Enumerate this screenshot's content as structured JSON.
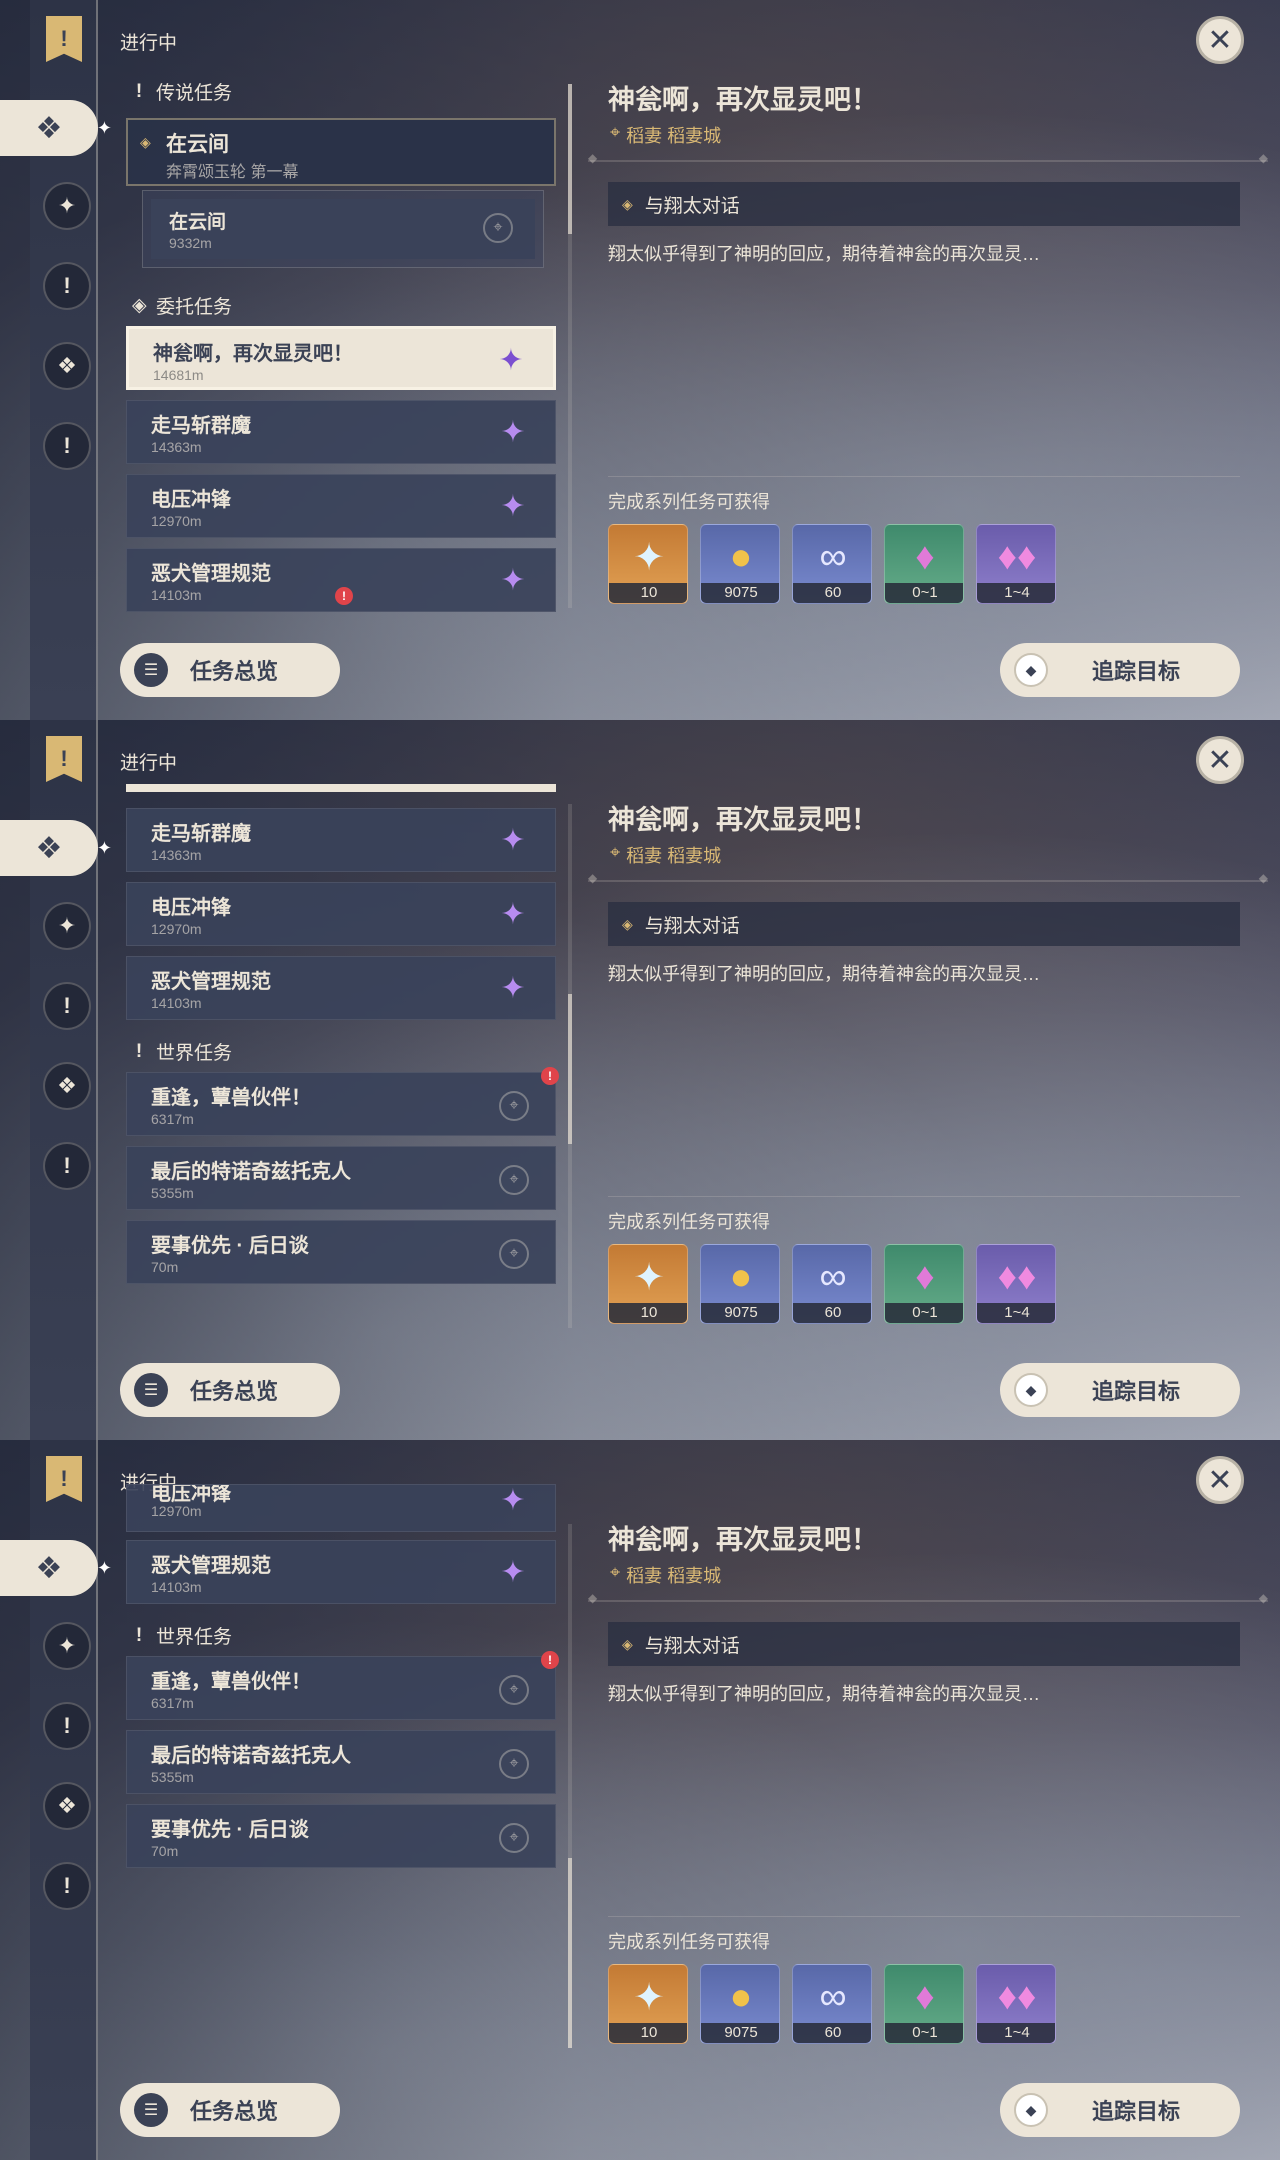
{
  "ui": {
    "status_label": "进行中",
    "overview_button": "任务总览",
    "track_button": "追踪目标",
    "rail_icons": [
      "bookmark-icon",
      "quest-all-icon",
      "archon-quest-icon",
      "world-quest-icon",
      "commission-icon",
      "exclamation-icon"
    ]
  },
  "detail": {
    "title": "神瓮啊，再次显灵吧！",
    "location": "稻妻  稻妻城",
    "objective": "与翔太对话",
    "description": "翔太似乎得到了神明的回应，期待着神瓮的再次显灵…",
    "rewards_label": "完成系列任务可获得",
    "rewards": [
      {
        "icon": "primogem-icon",
        "count": "10",
        "color": "#d8913f"
      },
      {
        "icon": "mora-icon",
        "count": "9075",
        "color": "#5868a8"
      },
      {
        "icon": "adventure-exp-icon",
        "count": "60",
        "color": "#5868a8"
      },
      {
        "icon": "crystal-icon",
        "count": "0~1",
        "color": "#3f8a6c"
      },
      {
        "icon": "crystal-cluster-icon",
        "count": "1~4",
        "color": "#6a5cab"
      }
    ]
  },
  "panel1": {
    "sections": [
      {
        "mark": "!",
        "label": "传说任务"
      },
      {
        "mark": "◈",
        "label": "委托任务"
      }
    ],
    "legend_quest": {
      "title": "在云间",
      "subtitle": "奔霄颂玉轮 第一幕"
    },
    "legend_sub": {
      "title": "在云间",
      "distance": "9332m"
    },
    "quests": [
      {
        "title": "神瓮啊，再次显灵吧！",
        "distance": "14681m"
      },
      {
        "title": "走马斩群魔",
        "distance": "14363m"
      },
      {
        "title": "电压冲锋",
        "distance": "12970m"
      },
      {
        "title": "恶犬管理规范",
        "distance": "14103m"
      }
    ]
  },
  "panel2": {
    "section": {
      "mark": "!",
      "label": "世界任务"
    },
    "commission": [
      {
        "title": "走马斩群魔",
        "distance": "14363m"
      },
      {
        "title": "电压冲锋",
        "distance": "12970m"
      },
      {
        "title": "恶犬管理规范",
        "distance": "14103m"
      }
    ],
    "world": [
      {
        "title": "重逢，蕈兽伙伴！",
        "distance": "6317m"
      },
      {
        "title": "最后的特诺奇兹托克人",
        "distance": "5355m"
      },
      {
        "title": "要事优先 · 后日谈",
        "distance": "70m"
      }
    ]
  },
  "panel3": {
    "section": {
      "mark": "!",
      "label": "世界任务"
    },
    "commission": [
      {
        "title": "电压冲锋",
        "distance": "12970m"
      },
      {
        "title": "恶犬管理规范",
        "distance": "14103m"
      }
    ],
    "world": [
      {
        "title": "重逢，蕈兽伙伴！",
        "distance": "6317m"
      },
      {
        "title": "最后的特诺奇兹托克人",
        "distance": "5355m"
      },
      {
        "title": "要事优先 · 后日谈",
        "distance": "70m"
      }
    ]
  }
}
